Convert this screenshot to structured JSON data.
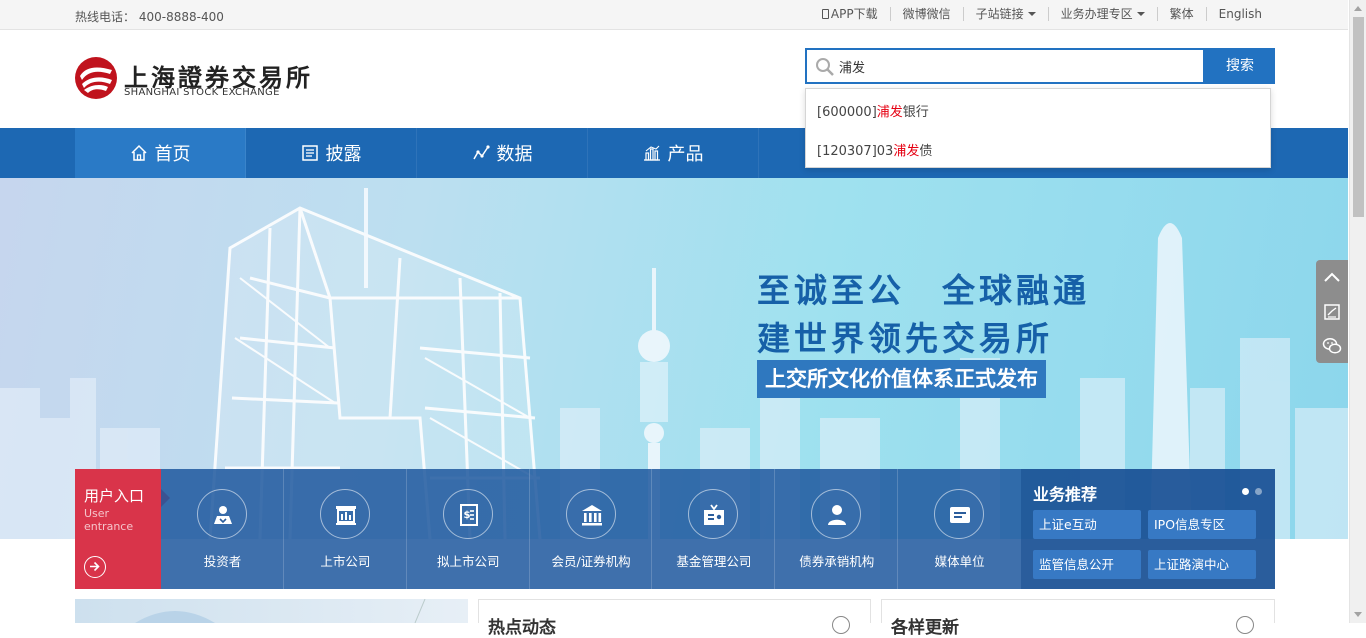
{
  "topbar": {
    "hotline_label": "热线电话：",
    "hotline_number": "400-8888-400",
    "links": {
      "app": "APP下载",
      "weibo": "微博微信",
      "subsites": "子站链接",
      "business": "业务办理专区",
      "traditional": "繁体",
      "english": "English"
    }
  },
  "logo": {
    "name_cn": "上海證券交易所",
    "name_en": "SHANGHAI STOCK EXCHANGE",
    "brand_color": "#c0131d"
  },
  "search": {
    "value": "浦发",
    "button": "搜索",
    "icon": "search-icon"
  },
  "suggestions": [
    {
      "code": "[600000]",
      "match": "浦发",
      "rest": "银行"
    },
    {
      "code": "[120307]03",
      "match": "浦发",
      "rest": "债"
    }
  ],
  "nav": {
    "items": [
      {
        "label": "首页",
        "icon": "home-icon"
      },
      {
        "label": "披露",
        "icon": "document-icon"
      },
      {
        "label": "数据",
        "icon": "line-chart-icon"
      },
      {
        "label": "产品",
        "icon": "bar-chart-icon"
      }
    ],
    "active": "首页",
    "color": "#1d68b3"
  },
  "banner": {
    "slogan_line1": "至诚至公　全球融通",
    "slogan_line2": "建世界领先交易所",
    "slogan_tag": "上交所文化价值体系正式发布"
  },
  "entry": {
    "title_cn": "用户入口",
    "title_en_1": "User",
    "title_en_2": "entrance",
    "cells": [
      {
        "label": "投资者",
        "icon": "investor-icon"
      },
      {
        "label": "上市公司",
        "icon": "listed-company-icon"
      },
      {
        "label": "拟上市公司",
        "icon": "pre-listing-icon"
      },
      {
        "label": "会员/证券机构",
        "icon": "institution-icon"
      },
      {
        "label": "基金管理公司",
        "icon": "fund-icon"
      },
      {
        "label": "债券承销机构",
        "icon": "bond-underwriter-icon"
      },
      {
        "label": "媒体单位",
        "icon": "media-icon"
      }
    ]
  },
  "business": {
    "title": "业务推荐",
    "buttons": [
      "上证e互动",
      "IPO信息专区",
      "监管信息公开",
      "上证路演中心"
    ]
  },
  "panels": {
    "hot_news": "热点动态",
    "second": "各样更新"
  }
}
